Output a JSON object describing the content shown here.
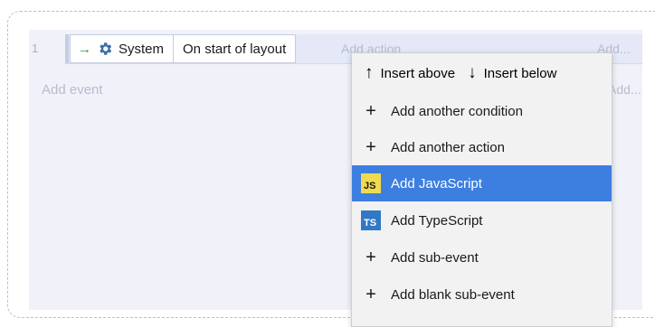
{
  "sheet": {
    "row_number": "1",
    "condition_object": "System",
    "condition_text": "On start of layout",
    "add_action": "Add action",
    "add_right_1": "Add...",
    "add_right_2": "Add...",
    "add_event": "Add event"
  },
  "menu": {
    "insert_above": "Insert above",
    "insert_below": "Insert below",
    "items": [
      {
        "label": "Add another condition",
        "icon": "plus-icon"
      },
      {
        "label": "Add another action",
        "icon": "plus-icon"
      },
      {
        "label": "Add JavaScript",
        "icon": "js-icon",
        "badge": "JS",
        "selected": true
      },
      {
        "label": "Add TypeScript",
        "icon": "ts-icon",
        "badge": "TS"
      },
      {
        "label": "Add sub-event",
        "icon": "plus-icon"
      },
      {
        "label": "Add blank sub-event",
        "icon": "plus-icon"
      }
    ]
  },
  "colors": {
    "selection": "#3d7fe0",
    "js_badge": "#f0db4f",
    "ts_badge": "#3178c6",
    "trigger_arrow": "#2e9c3f"
  }
}
